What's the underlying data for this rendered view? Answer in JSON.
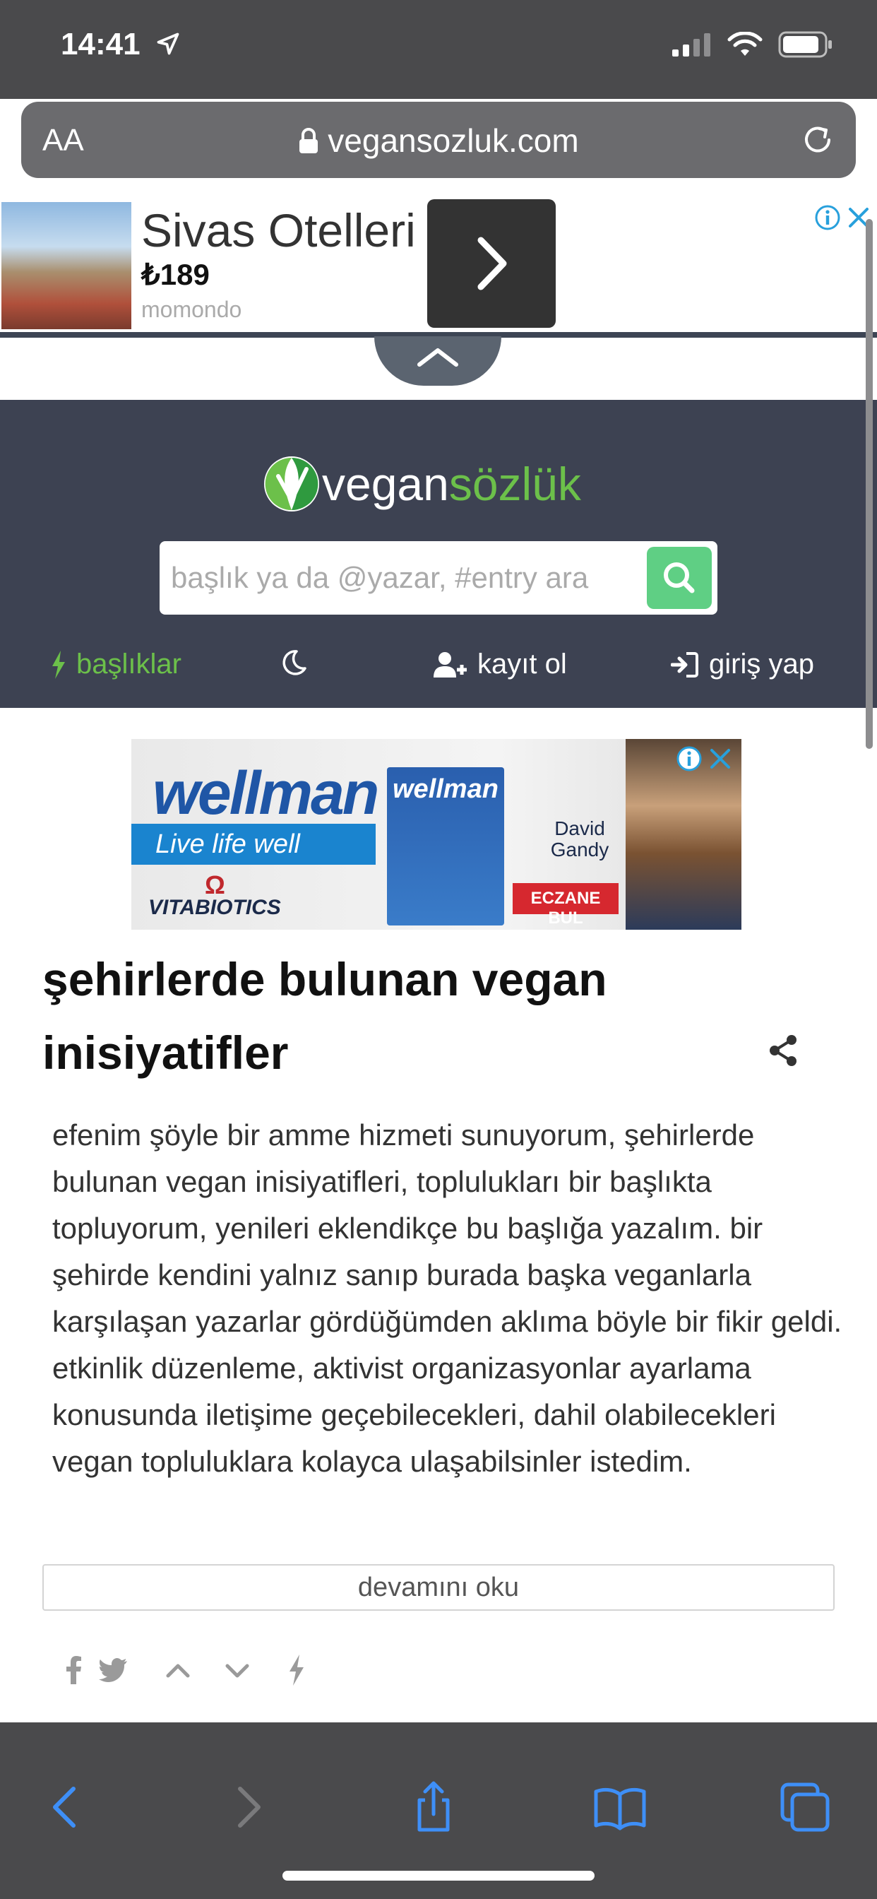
{
  "status_bar": {
    "time": "14:41"
  },
  "browser": {
    "text_size_label": "AA",
    "url": "vegansozluk.com"
  },
  "ad_top": {
    "title": "Sivas Otelleri",
    "price": "₺189",
    "advertiser": "momondo"
  },
  "site": {
    "logo_vegan": "vegan",
    "logo_sozluk": "sözlük",
    "search_placeholder": "başlık ya da @yazar, #entry ara",
    "nav": {
      "topics": "başlıklar",
      "register": "kayıt ol",
      "login": "giriş yap"
    }
  },
  "ad_mid": {
    "brand": "wellman",
    "tagline": "Live life well",
    "maker": "VITABIOTICS",
    "box_brand": "wellman",
    "person": "David Gandy",
    "cta": "ECZANE BUL"
  },
  "topic": {
    "title": "şehirlerde bulunan vegan inisiyatifler",
    "entry": "efenim şöyle bir amme hizmeti sunuyorum, şehirlerde bulunan vegan inisiyatifleri, toplulukları bir başlıkta topluyorum, yenileri eklendikçe bu başlığa yazalım. bir şehirde kendini yalnız sanıp burada başka veganlarla karşılaşan yazarlar gördüğümden aklıma böyle bir fikir geldi. etkinlik düzenleme, aktivist organizasyonlar ayarlama konusunda iletişime geçebilecekleri, dahil olabilecekleri vegan topluluklara kolayca ulaşabilsinler istedim.",
    "read_more": "devamını oku"
  },
  "colors": {
    "header_bg": "#3d4252",
    "accent_green": "#6cc04a",
    "search_btn": "#5fcf84",
    "ios_chrome": "#4a4a4c",
    "ios_blue": "#3e8ff7"
  }
}
